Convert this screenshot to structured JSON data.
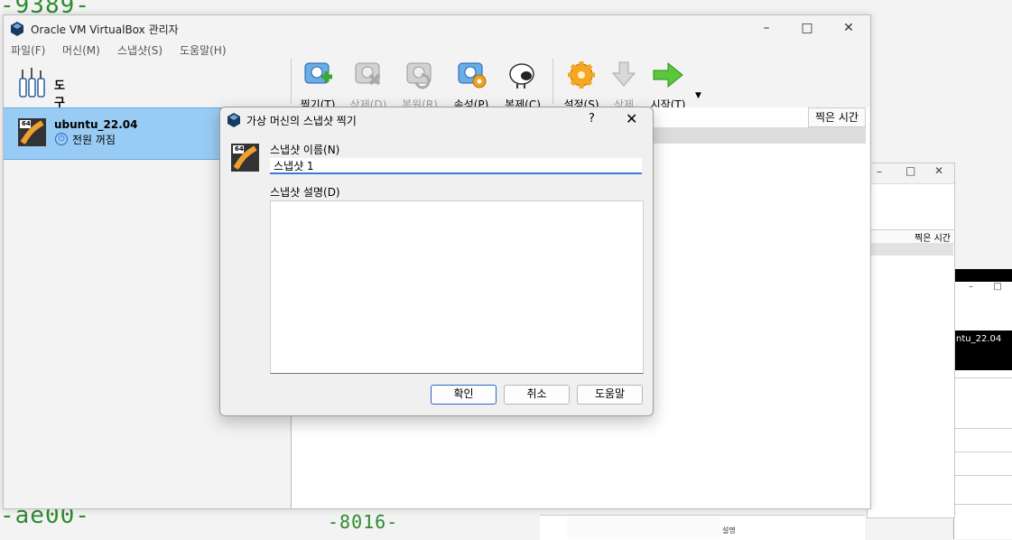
{
  "background": {
    "terminal_top": "-9389-",
    "terminal_bottom_left": "-ae00-",
    "terminal_bottom_mid": "-8016-"
  },
  "back_window": {
    "column_header": "찍은 시간",
    "vm_name_partial": "ntu_22.04",
    "status_partial": "설명"
  },
  "app": {
    "title": "Oracle VM VirtualBox 관리자"
  },
  "menu": [
    "파일(F)",
    "머신(M)",
    "스냅샷(S)",
    "도움말(H)"
  ],
  "tools_label": "도구",
  "vm": {
    "name": "ubuntu_22.04",
    "state": "전원 꺼짐",
    "badge": "64"
  },
  "toolbar": {
    "take": "찍기(T)",
    "delete": "삭제(D)",
    "restore": "복원(R)",
    "properties": "속성(P)",
    "clone": "복제(C)",
    "settings": "설정(S)",
    "remove": "삭제",
    "start": "시작(T)"
  },
  "snapshot_list": {
    "column_header": "찍은 시간"
  },
  "dialog": {
    "title": "가상 머신의 스냅샷 찍기",
    "help_glyph": "?",
    "name_label": "스냅샷 이름(N)",
    "name_value": "스냅샷 1",
    "desc_label": "스냅샷 설명(D)",
    "ok": "확인",
    "cancel": "취소",
    "help": "도움말"
  },
  "colors": {
    "selection": "#99ccf5",
    "accent": "#3a7bd5",
    "terminal_text": "#2e8b2e"
  }
}
